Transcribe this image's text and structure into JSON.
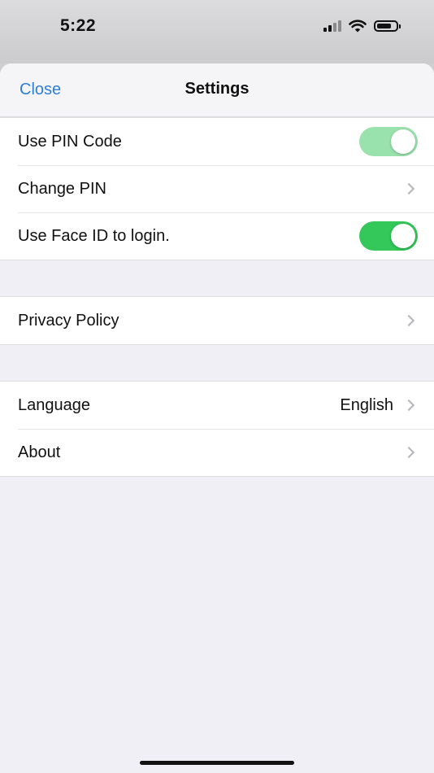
{
  "status_bar": {
    "time": "5:22",
    "icons": [
      "cellular-signal-icon",
      "wifi-icon",
      "battery-icon"
    ]
  },
  "nav": {
    "close_label": "Close",
    "title": "Settings"
  },
  "groups": {
    "security": {
      "pin_code": {
        "label": "Use PIN Code",
        "toggle_on": true
      },
      "change_pin": {
        "label": "Change PIN"
      },
      "face_id": {
        "label": "Use Face ID to login.",
        "toggle_on": true
      }
    },
    "legal": {
      "privacy_policy": {
        "label": "Privacy Policy"
      }
    },
    "general": {
      "language": {
        "label": "Language",
        "value": "English"
      },
      "about": {
        "label": "About"
      }
    }
  },
  "colors": {
    "accent": "#2e7fd6",
    "toggle_on": "#34c759",
    "toggle_on_faded": "#9ae2ad",
    "background": "#f0eff5"
  }
}
